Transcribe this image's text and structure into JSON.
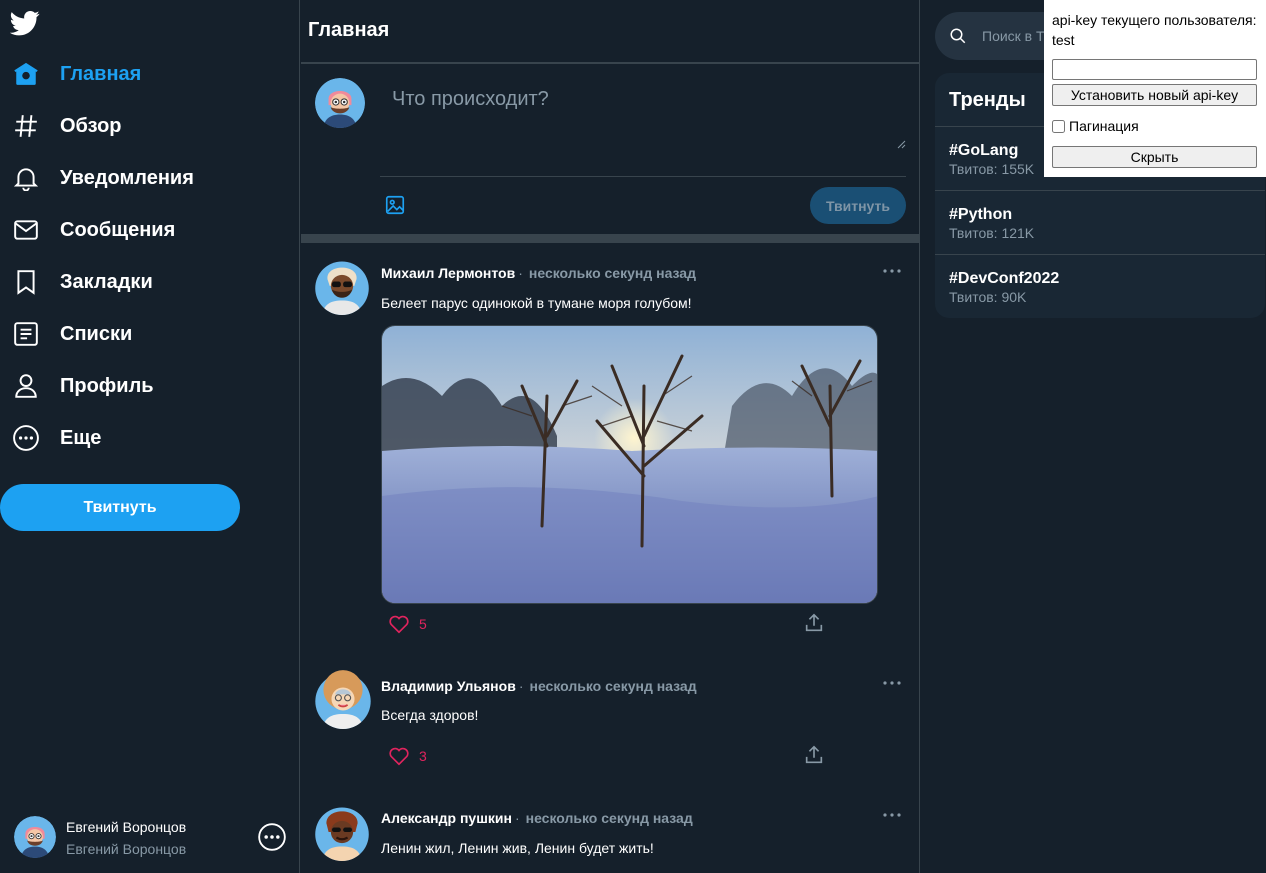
{
  "colors": {
    "background": "#15202b",
    "accent": "#1da1f2",
    "border": "#38444d",
    "muted_text": "#8899a6",
    "like": "#e0245e",
    "panel_bg": "#192734"
  },
  "sidebar": {
    "logo_icon": "twitter-bird-icon",
    "nav": [
      {
        "label": "Главная",
        "icon": "home-icon",
        "active": true
      },
      {
        "label": "Обзор",
        "icon": "hashtag-icon"
      },
      {
        "label": "Уведомления",
        "icon": "bell-icon"
      },
      {
        "label": "Сообщения",
        "icon": "envelope-icon"
      },
      {
        "label": "Закладки",
        "icon": "bookmark-icon"
      },
      {
        "label": "Списки",
        "icon": "list-icon"
      },
      {
        "label": "Профиль",
        "icon": "user-icon"
      },
      {
        "label": "Еще",
        "icon": "more-circle-icon"
      }
    ],
    "tweet_button": "Твитнуть",
    "account": {
      "name": "Евгений Воронцов",
      "handle": "Евгений Воронцов"
    }
  },
  "main": {
    "header_title": "Главная",
    "composer": {
      "placeholder": "Что происходит?",
      "submit_label": "Твитнуть"
    },
    "tweets": [
      {
        "author": "Михаил Лермонтов",
        "separator": "·",
        "time": "несколько секунд назад",
        "text": "Белеет парус одинокой в тумане моря голубом!",
        "has_photo": true,
        "likes": "5"
      },
      {
        "author": "Владимир Ульянов",
        "separator": "·",
        "time": "несколько секунд назад",
        "text": "Всегда здоров!",
        "has_photo": false,
        "likes": "3"
      },
      {
        "author": "Александр пушкин",
        "separator": "·",
        "time": "несколько секунд назад",
        "text": "Ленин жил, Ленин жив, Ленин будет жить!",
        "has_photo": false
      }
    ]
  },
  "right": {
    "search_placeholder": "Поиск в Твиттере",
    "trends_title": "Тренды",
    "trends": [
      {
        "tag": "#GoLang",
        "count": "Твитов: 155K"
      },
      {
        "tag": "#Python",
        "count": "Твитов: 121K"
      },
      {
        "tag": "#DevConf2022",
        "count": "Твитов: 90K"
      }
    ]
  },
  "api_panel": {
    "label": "api-key текущего пользователя: test",
    "key_value": "",
    "set_button": "Установить новый api-key",
    "pagination_label": "Пагинация",
    "pagination_checked": false,
    "hide_button": "Скрыть"
  }
}
